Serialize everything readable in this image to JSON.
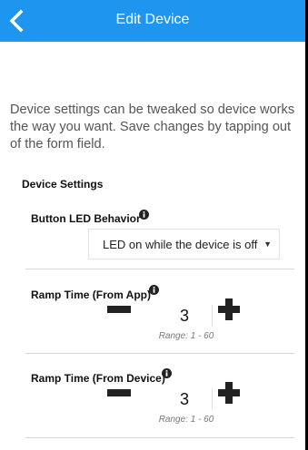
{
  "header": {
    "title": "Edit Device"
  },
  "description": "Device settings can be tweaked so device works the way you want. Save changes by tapping out of the form field.",
  "section": {
    "title": "Device Settings"
  },
  "led_behavior": {
    "label": "Button LED Behavior",
    "selected": "LED on while the device is off",
    "icon": "info-icon"
  },
  "ramp_app": {
    "label": "Ramp Time (From App)",
    "value": "3",
    "range": "Range: 1 - 60",
    "icon": "info-icon"
  },
  "ramp_device": {
    "label": "Ramp Time (From Device)",
    "value": "3",
    "range": "Range: 1 - 60",
    "icon": "info-icon"
  },
  "colors": {
    "header": "#1e95ee"
  }
}
